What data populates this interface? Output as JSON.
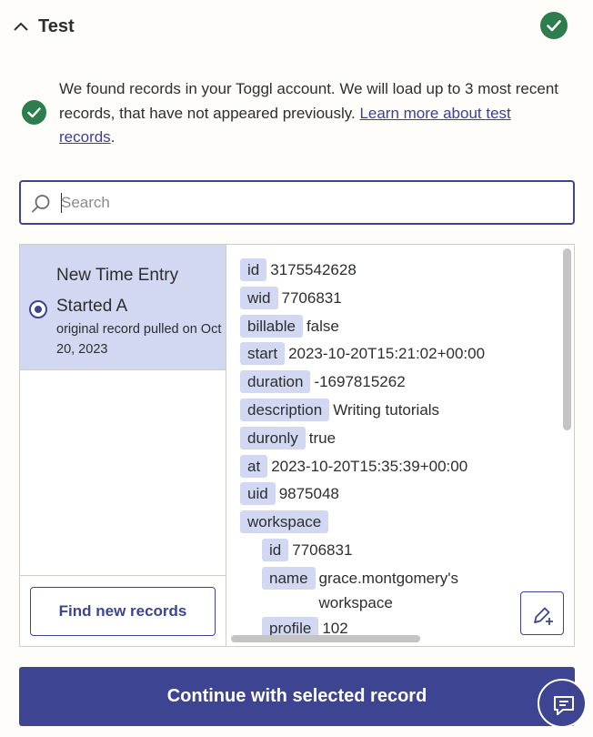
{
  "header": {
    "title": "Test",
    "status_icon": "check-circle-icon",
    "collapse_icon": "chevron-up-icon"
  },
  "message": {
    "text": "We found records in your Toggl account. We will load up to 3 most recent records, that have not appeared previously. ",
    "link": "Learn more about test records",
    "end": "."
  },
  "search": {
    "placeholder": "Search",
    "value": ""
  },
  "records": [
    {
      "title": "New Time Entry Started A",
      "subtitle": "original record pulled on Oct 20, 2023",
      "selected": true
    }
  ],
  "find_button": "Find new records",
  "fields": [
    {
      "key": "id",
      "value": "3175542628"
    },
    {
      "key": "wid",
      "value": "7706831"
    },
    {
      "key": "billable",
      "value": "false"
    },
    {
      "key": "start",
      "value": "2023-10-20T15:21:02+00:00"
    },
    {
      "key": "duration",
      "value": "-1697815262"
    },
    {
      "key": "description",
      "value": "Writing tutorials"
    },
    {
      "key": "duronly",
      "value": "true"
    },
    {
      "key": "at",
      "value": "2023-10-20T15:35:39+00:00"
    },
    {
      "key": "uid",
      "value": "9875048"
    },
    {
      "key": "workspace",
      "value": ""
    }
  ],
  "workspace_fields": [
    {
      "key": "id",
      "value": "7706831"
    },
    {
      "key": "name",
      "value": "grace.montgomery's workspace"
    },
    {
      "key": "profile",
      "value": "102"
    }
  ],
  "continue_button": "Continue with selected record",
  "colors": {
    "accent": "#3d4592",
    "selected_bg": "#d3d8f2",
    "success": "#2e7d4f",
    "background": "#fffdf9"
  }
}
